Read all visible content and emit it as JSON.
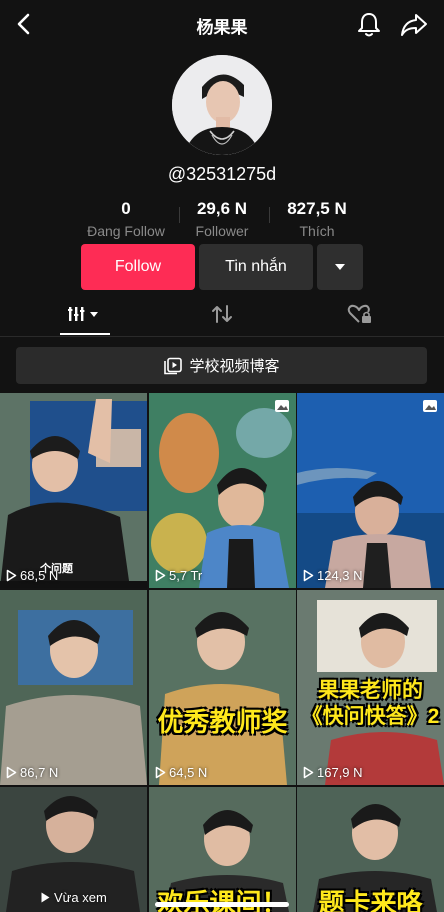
{
  "header": {
    "title": "杨果果",
    "back_icon": "back-arrow-icon",
    "bell_icon": "bell-icon",
    "share_icon": "share-icon"
  },
  "profile": {
    "handle": "@32531275d",
    "stats": [
      {
        "value": "0",
        "label": "Đang Follow"
      },
      {
        "value": "29,6 N",
        "label": "Follower"
      },
      {
        "value": "827,5 N",
        "label": "Thích"
      }
    ]
  },
  "actions": {
    "follow_label": "Follow",
    "message_label": "Tin nhắn",
    "more_icon": "caret-down-icon"
  },
  "tabs": [
    {
      "name": "videos",
      "icon": "grid-bars-icon",
      "active": true
    },
    {
      "name": "reposts",
      "icon": "repost-icon"
    },
    {
      "name": "liked",
      "icon": "heart-lock-icon"
    }
  ],
  "playlist": {
    "label": "学校视频博客"
  },
  "videos": [
    {
      "views": "68,5 N",
      "caption": "个问题"
    },
    {
      "views": "5,7 Tr"
    },
    {
      "views": "124,3 N"
    },
    {
      "views": "86,7 N"
    },
    {
      "views": "64,5 N",
      "caption": "优秀教师奖"
    },
    {
      "views": "167,9 N",
      "caption": "果果老师的《快问快答》2"
    },
    {
      "views": "Vừa xem"
    },
    {
      "views": "",
      "caption": "欢乐课间！"
    },
    {
      "views": "",
      "caption": "题卡来咯"
    }
  ],
  "colors": {
    "accent": "#fe2c55",
    "background": "#121212",
    "button_dark": "#2f2f2f"
  }
}
